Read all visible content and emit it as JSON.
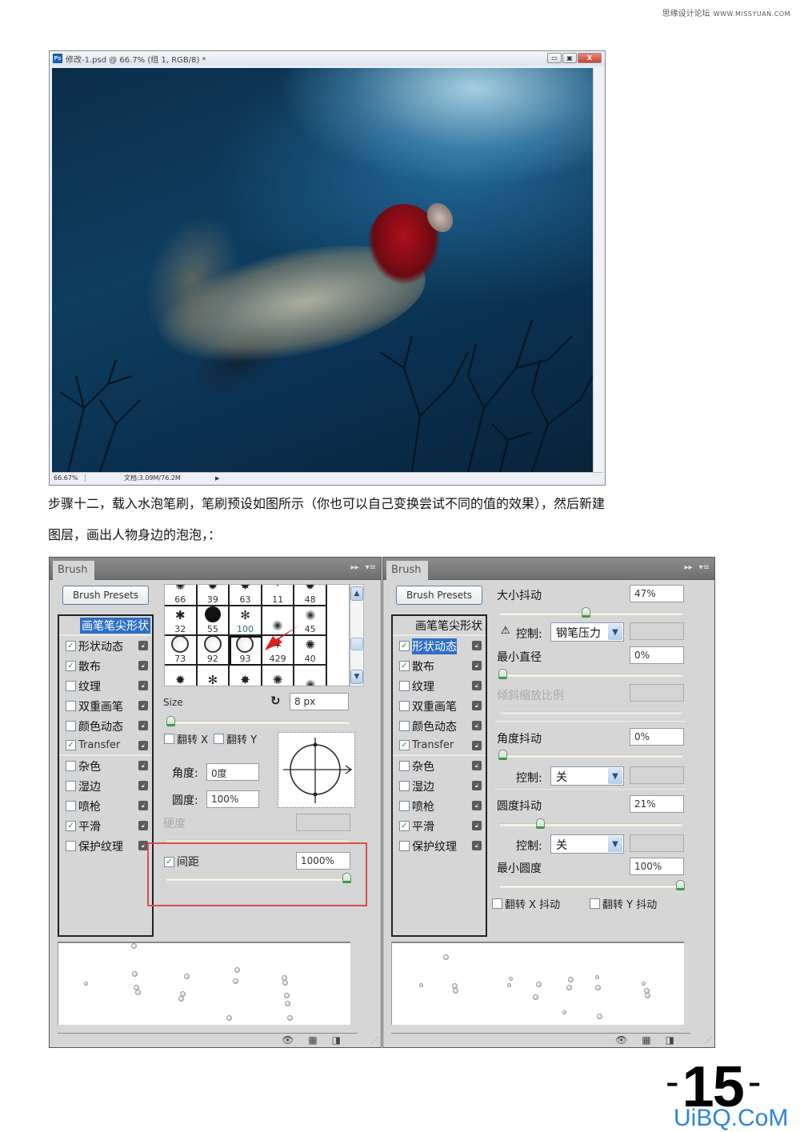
{
  "site_header": {
    "name": "思缘设计论坛",
    "url": "WWW.MISSYUAN.COM"
  },
  "ps_window": {
    "title": "修改-1.psd @ 66.7% (组 1, RGB/8) *",
    "logo": "Ps",
    "controls": {
      "minimize": "▭",
      "maximize": "▣",
      "close": "X"
    },
    "status": {
      "zoom": "66.67%",
      "doc_info": "文档:3.09M/76.2M",
      "arrow": "▶"
    }
  },
  "step_text": {
    "line1": "步骤十二，载入水泡笔刷，笔刷预设如图所示（你也可以自己变换尝试不同的值的效果），然后新建",
    "line2": "图层，画出人物身边的泡泡，："
  },
  "left_panel": {
    "tab": "Brush",
    "presets_button": "Brush Presets",
    "options": [
      {
        "label": "画笔笔尖形状",
        "checked": null,
        "highlighted": true
      },
      {
        "label": "形状动态",
        "checked": true
      },
      {
        "label": "散布",
        "checked": true
      },
      {
        "label": "纹理",
        "checked": false
      },
      {
        "label": "双重画笔",
        "checked": false
      },
      {
        "label": "颜色动态",
        "checked": false
      },
      {
        "label": "Transfer",
        "checked": true
      },
      {
        "label": "杂色",
        "checked": false
      },
      {
        "label": "湿边",
        "checked": false
      },
      {
        "label": "喷枪",
        "checked": false
      },
      {
        "label": "平滑",
        "checked": true
      },
      {
        "label": "保护纹理",
        "checked": false
      }
    ],
    "brush_tips": [
      "66",
      "39",
      "63",
      "11",
      "48",
      "32",
      "55",
      "100",
      "",
      "45",
      "73",
      "92",
      "93",
      "429",
      "40",
      "",
      "",
      "",
      "",
      ""
    ],
    "selected_tip": "93",
    "size_label": "Size",
    "size_value": "8 px",
    "size_fraction": 0.01,
    "flip_x": "翻转 X",
    "flip_y": "翻转 Y",
    "flip_x_checked": false,
    "flip_y_checked": false,
    "angle_label": "角度:",
    "angle_value": "0度",
    "roundness_label": "圆度:",
    "roundness_value": "100%",
    "hardness_label": "硬度",
    "spacing_label": "间距",
    "spacing_checked": true,
    "spacing_value": "1000%",
    "spacing_fraction": 1.0
  },
  "right_panel": {
    "tab": "Brush",
    "presets_button": "Brush Presets",
    "options": [
      {
        "label": "画笔笔尖形状",
        "checked": null
      },
      {
        "label": "形状动态",
        "checked": true,
        "highlighted": true
      },
      {
        "label": "散布",
        "checked": true
      },
      {
        "label": "纹理",
        "checked": false
      },
      {
        "label": "双重画笔",
        "checked": false
      },
      {
        "label": "颜色动态",
        "checked": false
      },
      {
        "label": "Transfer",
        "checked": true
      },
      {
        "label": "杂色",
        "checked": false
      },
      {
        "label": "湿边",
        "checked": false
      },
      {
        "label": "喷枪",
        "checked": false
      },
      {
        "label": "平滑",
        "checked": true
      },
      {
        "label": "保护纹理",
        "checked": false
      }
    ],
    "size_jitter_label": "大小抖动",
    "size_jitter_value": "47%",
    "size_jitter_fraction": 0.47,
    "control_label": "控制:",
    "control_warn": "⚠",
    "control1_value": "钢笔压力",
    "min_diameter_label": "最小直径",
    "min_diameter_value": "0%",
    "min_diameter_fraction": 0.0,
    "tilt_scale_label": "倾斜缩放比例",
    "angle_jitter_label": "角度抖动",
    "angle_jitter_value": "0%",
    "angle_jitter_fraction": 0.0,
    "control2_value": "关",
    "roundness_jitter_label": "圆度抖动",
    "roundness_jitter_value": "21%",
    "roundness_jitter_fraction": 0.21,
    "control3_value": "关",
    "min_roundness_label": "最小圆度",
    "min_roundness_value": "100%",
    "min_roundness_fraction": 1.0,
    "flip_x_jitter": "翻转 X 抖动",
    "flip_y_jitter": "翻转 Y 抖动"
  },
  "footer": {
    "page_number": "15",
    "dash": "-",
    "watermark": "UiBQ.CoM"
  }
}
